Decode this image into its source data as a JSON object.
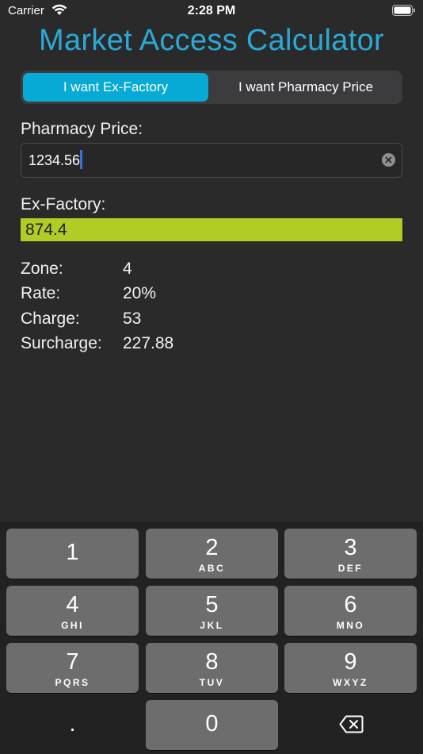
{
  "status_bar": {
    "carrier": "Carrier",
    "time": "2:28 PM"
  },
  "app": {
    "title": "Market Access Calculator"
  },
  "mode_toggle": {
    "options": [
      "I want Ex-Factory",
      "I want Pharmacy Price"
    ],
    "selected": "I want Ex-Factory"
  },
  "pharmacy_price": {
    "label": "Pharmacy Price:",
    "value": "1234.56"
  },
  "ex_factory": {
    "label": "Ex-Factory:",
    "value": "874.4"
  },
  "details": [
    {
      "label": "Zone:",
      "value": "4"
    },
    {
      "label": "Rate:",
      "value": "20%"
    },
    {
      "label": "Charge:",
      "value": "53"
    },
    {
      "label": "Surcharge:",
      "value": "227.88"
    }
  ],
  "keypad": {
    "keys": [
      {
        "num": "1",
        "letters": ""
      },
      {
        "num": "2",
        "letters": "ABC"
      },
      {
        "num": "3",
        "letters": "DEF"
      },
      {
        "num": "4",
        "letters": "GHI"
      },
      {
        "num": "5",
        "letters": "JKL"
      },
      {
        "num": "6",
        "letters": "MNO"
      },
      {
        "num": "7",
        "letters": "PQRS"
      },
      {
        "num": "8",
        "letters": "TUV"
      },
      {
        "num": "9",
        "letters": "WXYZ"
      },
      {
        "num": ".",
        "letters": ""
      },
      {
        "num": "0",
        "letters": ""
      }
    ],
    "delete_icon": "delete-left-icon"
  },
  "colors": {
    "title": "#2aa9d6",
    "segment_active": "#06aad5",
    "result_bar": "#b2cc26",
    "background": "#2a2a2a"
  }
}
